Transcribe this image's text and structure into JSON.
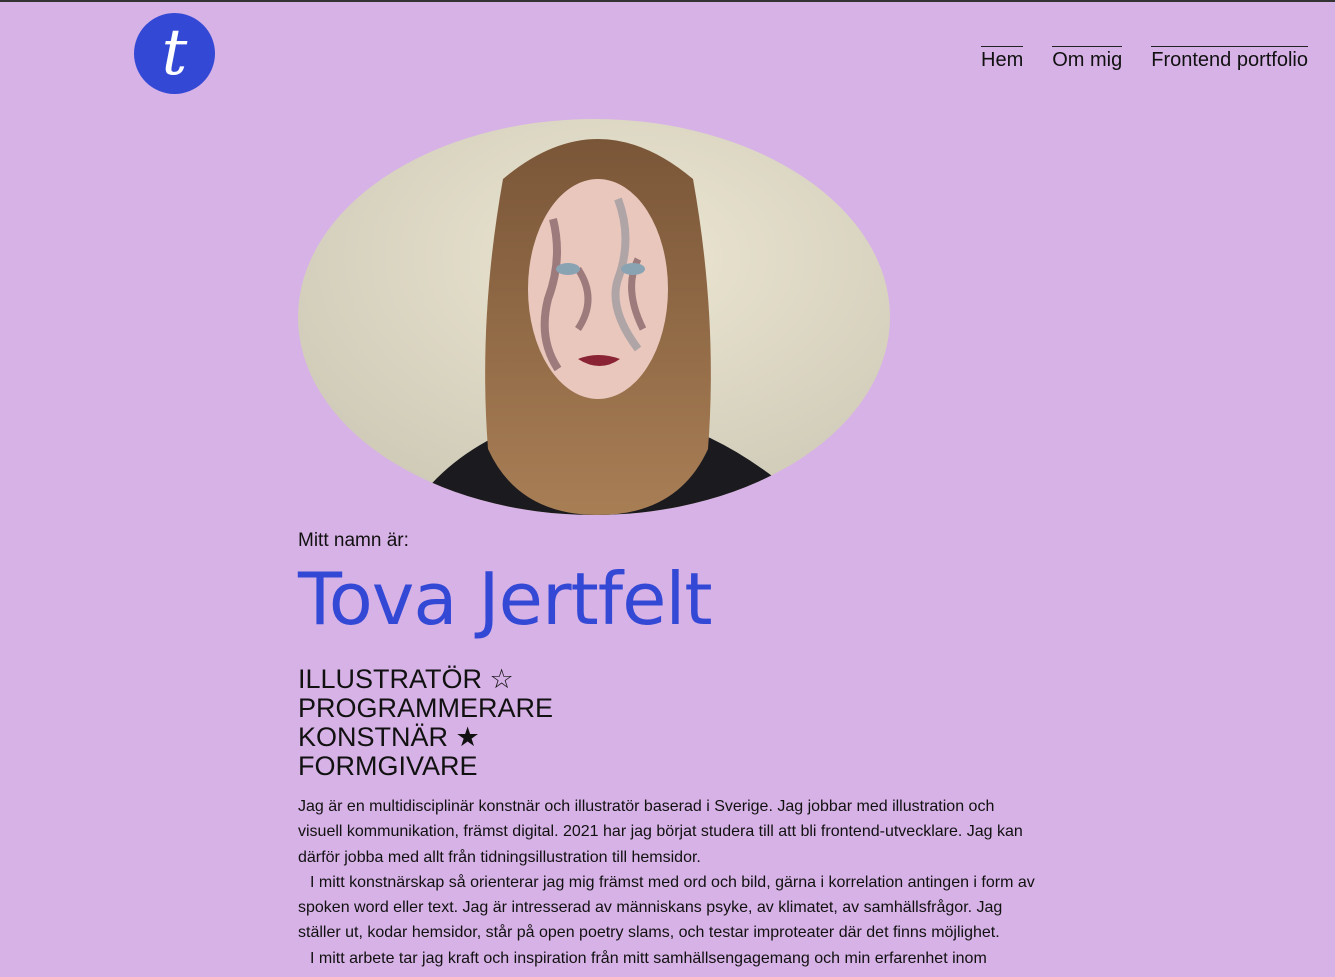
{
  "header": {
    "logo_letter": "t",
    "nav": [
      {
        "label": "Hem"
      },
      {
        "label": "Om mig"
      },
      {
        "label": "Frontend portfolio"
      }
    ]
  },
  "main": {
    "intro": "Mitt namn är:",
    "name": "Tova Jertfelt",
    "roles": [
      "ILLUSTRATÖR ☆",
      "PROGRAMMERARE",
      "KONSTNÄR ★",
      "FORMGIVARE"
    ],
    "bio": [
      "Jag är en multidisciplinär konstnär och illustratör baserad i Sverige. Jag jobbar med illustration och visuell kommunikation, främst digital. 2021 har jag börjat studera till att bli frontend-utvecklare. Jag kan därför jobba med allt från tidningsillustration till hemsidor.",
      "I mitt konstnärskap så orienterar jag mig främst med ord och bild, gärna i korrelation antingen i form av spoken word eller text. Jag är intresserad av människans psyke, av klimatet, av samhällsfrågor. Jag ställer ut, kodar hemsidor, står på open poetry slams, och testar improteater där det finns möjlighet.",
      "I mitt arbete tar jag kraft och inspiration från mitt samhällsengagemang och min erfarenhet inom"
    ]
  },
  "colors": {
    "background": "#d7b2e6",
    "accent": "#3349d6"
  }
}
